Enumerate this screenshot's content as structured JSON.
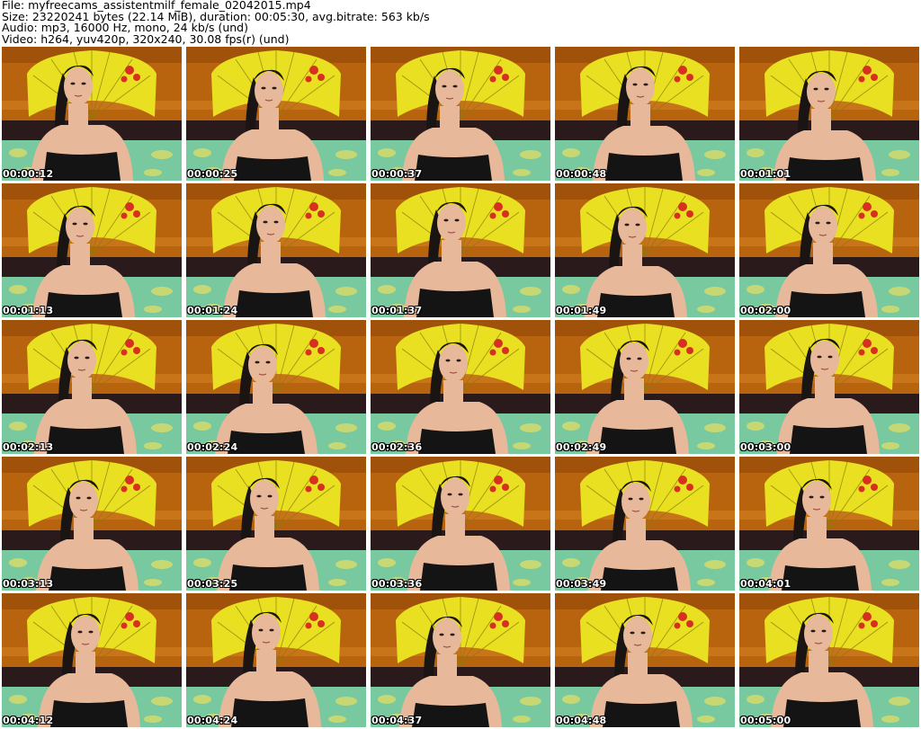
{
  "header": {
    "file": "File: myfreecams_assistentmilf_female_02042015.mp4",
    "size": "Size: 23220241 bytes (22.14 MiB), duration: 00:05:30, avg.bitrate: 563 kb/s",
    "audio": "Audio: mp3, 16000 Hz, mono, 24 kb/s (und)",
    "video": "Video: h264, yuv420p, 320x240, 30.08 fps(r) (und)"
  },
  "colors": {
    "wall": "#b8640e",
    "fan": "#e8e020",
    "fan_rib": "#8a7a10",
    "flower": "#d83020",
    "skin": "#e8b89a",
    "hair": "#1a1412",
    "top": "#141414",
    "bed": "#78c8a0",
    "bed_pattern": "#e8e060",
    "couch": "#2a1a1c"
  },
  "thumbnails": [
    {
      "timestamp": "00:00:12"
    },
    {
      "timestamp": "00:00:25"
    },
    {
      "timestamp": "00:00:37"
    },
    {
      "timestamp": "00:00:48"
    },
    {
      "timestamp": "00:01:01"
    },
    {
      "timestamp": "00:01:13"
    },
    {
      "timestamp": "00:01:24"
    },
    {
      "timestamp": "00:01:37"
    },
    {
      "timestamp": "00:01:49"
    },
    {
      "timestamp": "00:02:00"
    },
    {
      "timestamp": "00:02:13"
    },
    {
      "timestamp": "00:02:24"
    },
    {
      "timestamp": "00:02:36"
    },
    {
      "timestamp": "00:02:49"
    },
    {
      "timestamp": "00:03:00"
    },
    {
      "timestamp": "00:03:13"
    },
    {
      "timestamp": "00:03:25"
    },
    {
      "timestamp": "00:03:36"
    },
    {
      "timestamp": "00:03:49"
    },
    {
      "timestamp": "00:04:01"
    },
    {
      "timestamp": "00:04:12"
    },
    {
      "timestamp": "00:04:24"
    },
    {
      "timestamp": "00:04:37"
    },
    {
      "timestamp": "00:04:48"
    },
    {
      "timestamp": "00:05:00"
    }
  ]
}
